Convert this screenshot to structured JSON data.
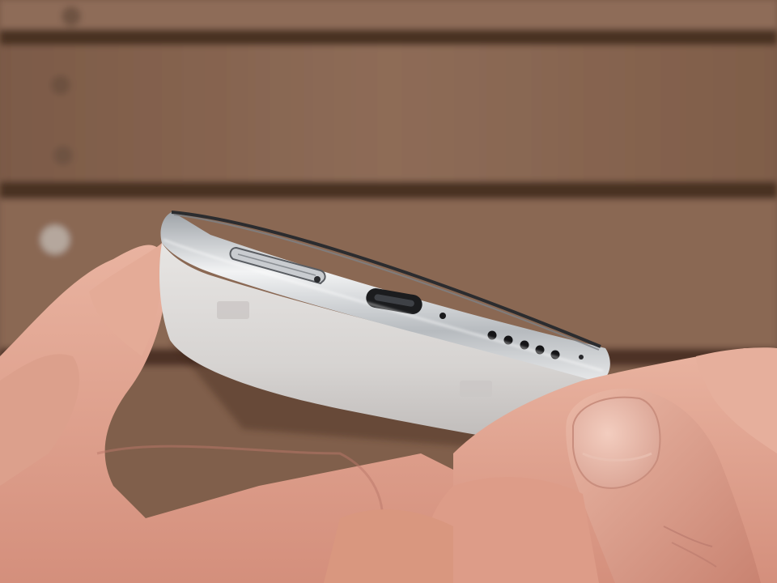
{
  "scene": {
    "subject": "smartphone-bottom-edge",
    "background": "wooden-planks",
    "colors": {
      "wood_light": "#8c6a55",
      "wood_dark": "#5a3d2e",
      "plank_gap": "#3b2619",
      "phone_body": "#d9d6d4",
      "phone_frame": "#b9bbbe",
      "skin": "#e3a892",
      "skin_shadow": "#b9786a"
    },
    "ports": {
      "sim_tray": "sim-tray-icon",
      "usb_c": "usb-c-port-icon",
      "microphone": "microphone-hole-icon",
      "speaker_holes": 6
    }
  }
}
